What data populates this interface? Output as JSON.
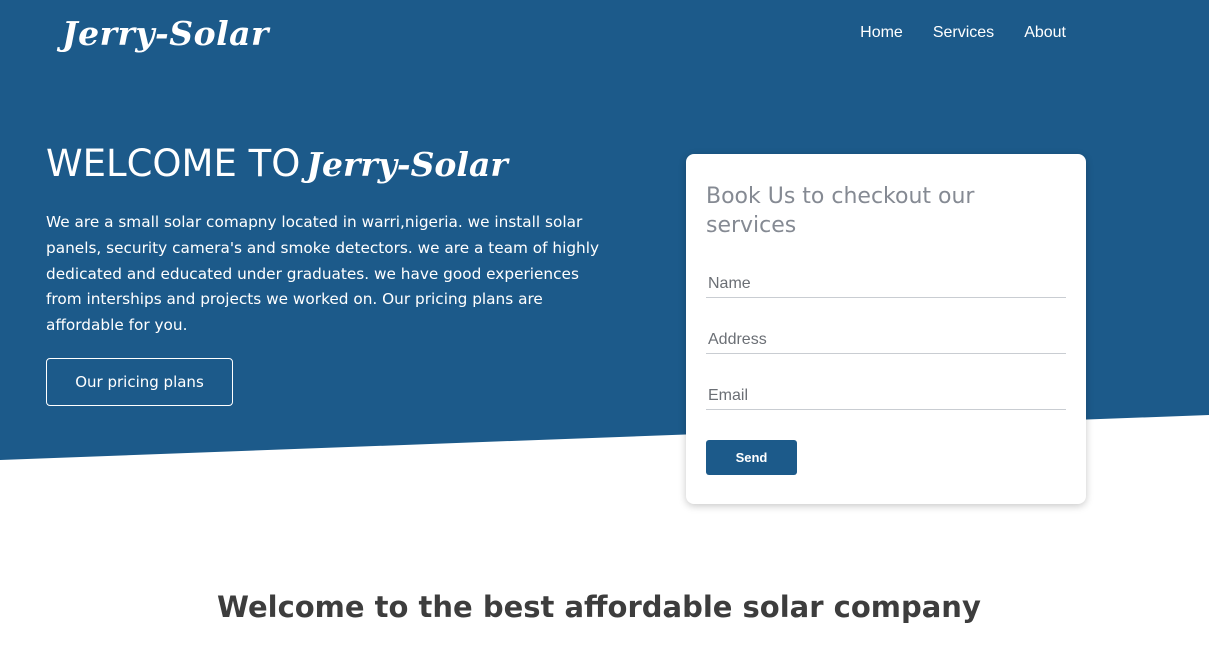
{
  "brand": {
    "logo_text": "Jerry-Solar"
  },
  "nav": {
    "items": [
      {
        "label": "Home"
      },
      {
        "label": "Services"
      },
      {
        "label": "About"
      }
    ]
  },
  "hero": {
    "title_prefix": "WELCOME TO",
    "title_brand": "Jerry-Solar",
    "description": "We are a small solar comapny located in warri,nigeria. we install solar panels, security camera's and smoke detectors. we are a team of highly dedicated and educated under graduates. we have good experiences from interships and projects we worked on. Our pricing plans are affordable for you.",
    "pricing_button": "Our pricing plans"
  },
  "booking": {
    "title": "Book Us to checkout our services",
    "name_placeholder": "Name",
    "address_placeholder": "Address",
    "email_placeholder": "Email",
    "send_label": "Send"
  },
  "section": {
    "title": "Welcome to the best affordable solar company"
  },
  "colors": {
    "primary": "#1c5a8a",
    "card_title": "#858a93",
    "heading_dark": "#3d3d3d"
  }
}
